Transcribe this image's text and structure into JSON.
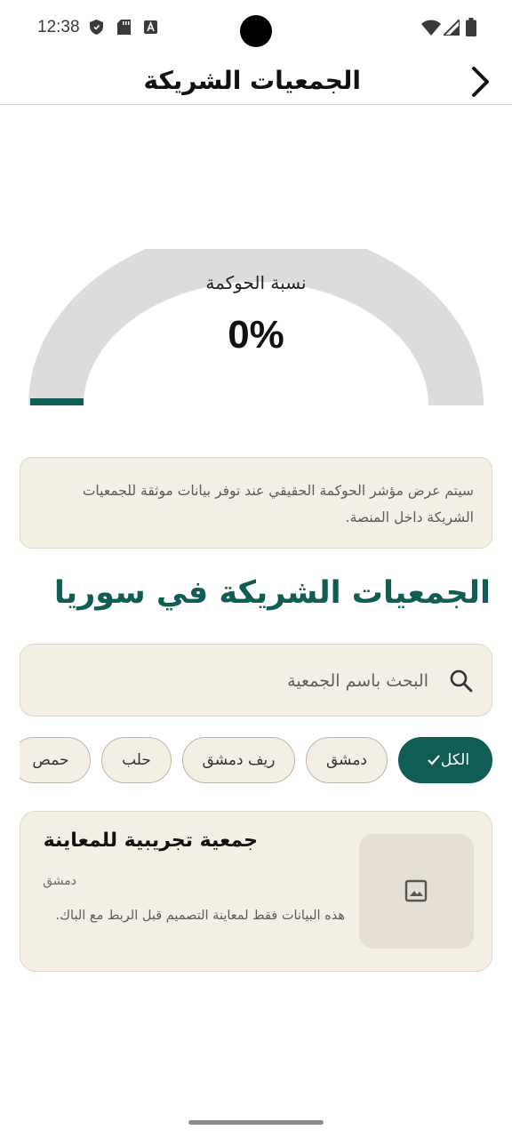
{
  "status_bar": {
    "time": "12:38",
    "icons": [
      "shield-icon",
      "sd-card-icon",
      "keyboard-a-icon",
      "wifi-icon",
      "signal-icon",
      "battery-icon"
    ]
  },
  "app_bar": {
    "title": "الجمعيات الشريكة",
    "back_icon": "chevron-right-icon"
  },
  "gauge": {
    "label": "نسبة الحوكمة",
    "value_text": "0%",
    "value": 0,
    "track_color": "#dcdcdc",
    "fill_color": "#0f5d55"
  },
  "notice": {
    "text": "سيتم عرض مؤشر الحوكمة الحقيقي عند توفر بيانات موثقة للجمعيات الشريكة داخل المنصة."
  },
  "section": {
    "title": "الجمعيات الشريكة في سوريا"
  },
  "search": {
    "placeholder": "البحث باسم الجمعية",
    "value": ""
  },
  "filters": {
    "chips": [
      {
        "label": "الكل",
        "selected": true
      },
      {
        "label": "دمشق",
        "selected": false
      },
      {
        "label": "ريف دمشق",
        "selected": false
      },
      {
        "label": "حلب",
        "selected": false
      },
      {
        "label": "حمص",
        "selected": false
      }
    ]
  },
  "associations": [
    {
      "name": "جمعية تجريبية للمعاينة",
      "city": "دمشق",
      "description": "هذه البيانات فقط لمعاينة التصميم قبل الربط مع الباك."
    }
  ],
  "colors": {
    "accent": "#0f5d55",
    "card_bg": "#f3efe5",
    "card_border": "#ddd7c8"
  }
}
